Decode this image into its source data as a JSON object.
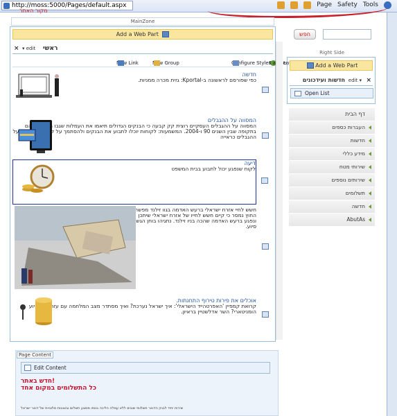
{
  "browser": {
    "address": "http://moss:5000/Pages/default.aspx",
    "tools": [
      "Page",
      "Safety",
      "Tools"
    ]
  },
  "header": {
    "red_link": "מקור האתר"
  },
  "main_zone": {
    "label": "MainZone",
    "add_web_part": "Add a Web Part",
    "web_part": {
      "title": "ראשי",
      "edit": "edit",
      "close": "×"
    },
    "toolbar": {
      "reorder": "Reorder",
      "configure": "Configure Styles and Layout",
      "new_group": "New Group",
      "new_link": "New Link"
    },
    "items": [
      {
        "headline": "חדשה",
        "body": "כפי שפורסם לראשונה ב-Kportal: גזית מכרה ממניות."
      },
      {
        "headline": "המסווה על ההגבלים",
        "body": "המסווה על ההגבלים העסקיים רוצית קק קבעה כי הבנקים הגדולים תיאמו את העמלות שגבו מלקוחותיהם בתקופה שבין השנים 90 ו-2004. המשמעות: לקוחות יוכלו לתבוע את הבנקים ולהסתמך על קביעת הממונה על ההגבלים כראייה"
      },
      {
        "headline": "דיעה",
        "body": "לקוח שנפגע יכול לתבוע בבית המשפט"
      },
      {
        "headline": "",
        "body": "חשש לחיי אזרח ישראלי ברעש האדמה בגוו זילנד מפשרד החוץ נמסר כי קיים חשש לחייו של אזרח ישראלי שיתכן ונפגע ברעש האדמה שהכה בניו זילנד. נתגיהו בוחן הגשת סיוע."
      },
      {
        "headline": "אוכלים את פירות טירוף התחנתות.",
        "body": "קרואת קמפיין 'האפרטהייד הישראלי': איך ישראל נערכת? ואיך מסתדר מצב המלחמה עם עזה לצד סיוע הומניטארי? השר אדלשטיין בראיון."
      }
    ]
  },
  "right_zone": {
    "search_button": "חפש",
    "label": "Right Side",
    "add_web_part": "Add a Web Part",
    "web_part": {
      "title": "חדשות ועידכונים",
      "edit": "edit",
      "close": "×"
    },
    "open_list": "Open List"
  },
  "nav": [
    "דף הבית",
    "העברות כספים",
    "חדשות",
    "מידע כללי",
    "שירותי מטח",
    "שירותים נוספים",
    "תשלומים",
    "חדשה",
    "AbutAs"
  ],
  "page_content": {
    "tab": "Page Content",
    "edit": "Edit Content",
    "line1": "!חדש באתר",
    "line2": "כל התשלומים במקום אחד",
    "footer": "שירות יחיד לבנק הדואר תשלומי שובים ללא עמלה הליכה בנופו ממצע תשלום ובוצונות מלגניות של דואר ישראל"
  }
}
